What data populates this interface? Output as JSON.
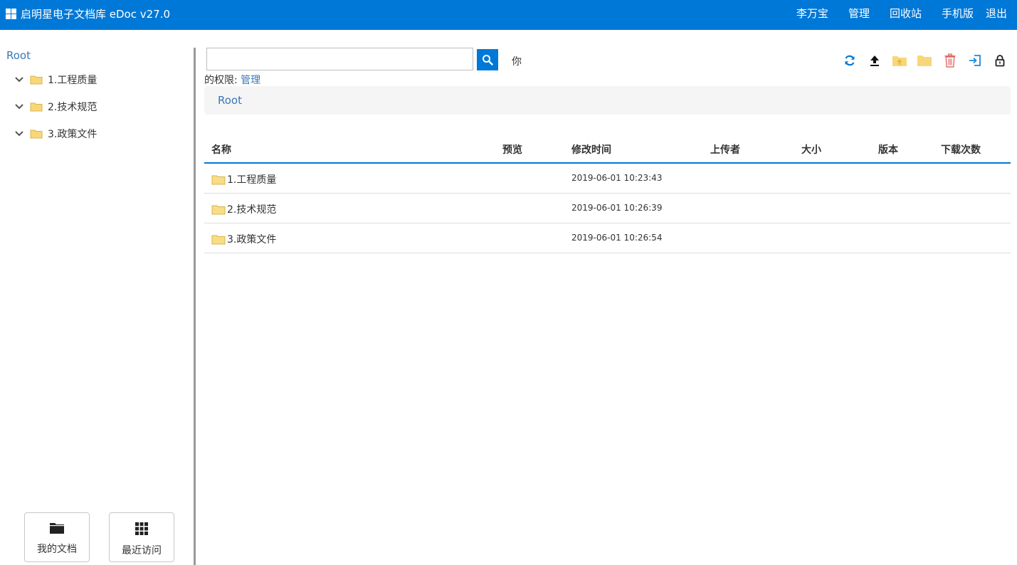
{
  "header": {
    "brand": "启明星电子文档库 eDoc v27.0",
    "nav": {
      "user": "李万宝",
      "admin": "管理",
      "recycle": "回收站",
      "mobile": "手机版",
      "logout": "退出"
    }
  },
  "sidebar": {
    "root_label": "Root",
    "items": [
      {
        "label": "1.工程质量"
      },
      {
        "label": "2.技术规范"
      },
      {
        "label": "3.政策文件"
      }
    ],
    "buttons": {
      "my_docs": "我的文档",
      "recent": "最近访问"
    }
  },
  "search": {
    "value": "",
    "placeholder": ""
  },
  "permission": {
    "prefix_a": "你",
    "prefix_b": "的权限:",
    "value": "管理"
  },
  "breadcrumb": {
    "root": "Root"
  },
  "table": {
    "columns": [
      "名称",
      "预览",
      "修改时间",
      "上传者",
      "大小",
      "版本",
      "下载次数"
    ],
    "rows": [
      {
        "name": "1.工程质量",
        "modified": "2019-06-01 10:23:43"
      },
      {
        "name": "2.技术规范",
        "modified": "2019-06-01 10:26:39"
      },
      {
        "name": "3.政策文件",
        "modified": "2019-06-01 10:26:54"
      }
    ]
  },
  "colors": {
    "primary": "#0078d7",
    "link": "#3a76b8",
    "folder": "#f7d77a",
    "delete": "#d9534f"
  },
  "icons": {
    "toolbar": [
      "refresh-icon",
      "upload-icon",
      "folder-up-icon",
      "new-folder-icon",
      "trash-icon",
      "login-icon",
      "lock-icon"
    ]
  }
}
